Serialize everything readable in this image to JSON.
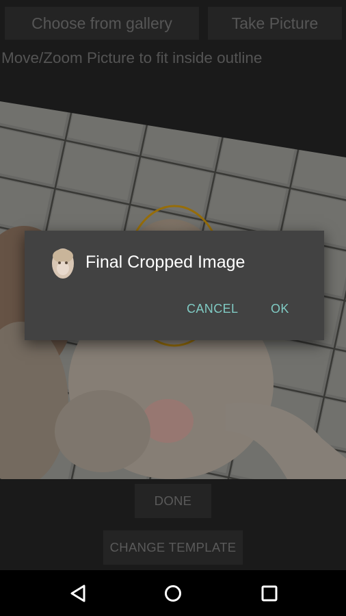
{
  "top_buttons": {
    "gallery": "Choose from gallery",
    "take_picture": "Take Picture"
  },
  "instructions": "Move/Zoom Picture to fit inside outline",
  "bottom_buttons": {
    "done": "DONE",
    "change_template": "CHANGE TEMPLATE"
  },
  "dialog": {
    "title": "Final Cropped Image",
    "cancel": "CANCEL",
    "ok": "OK",
    "icon": "cropped-face-thumbnail"
  },
  "navbar": {
    "icons": [
      "back-icon",
      "home-icon",
      "recents-icon"
    ]
  },
  "colors": {
    "accent": "#80cbc4",
    "dialog_bg": "#424242",
    "outline": "#b8860b"
  }
}
